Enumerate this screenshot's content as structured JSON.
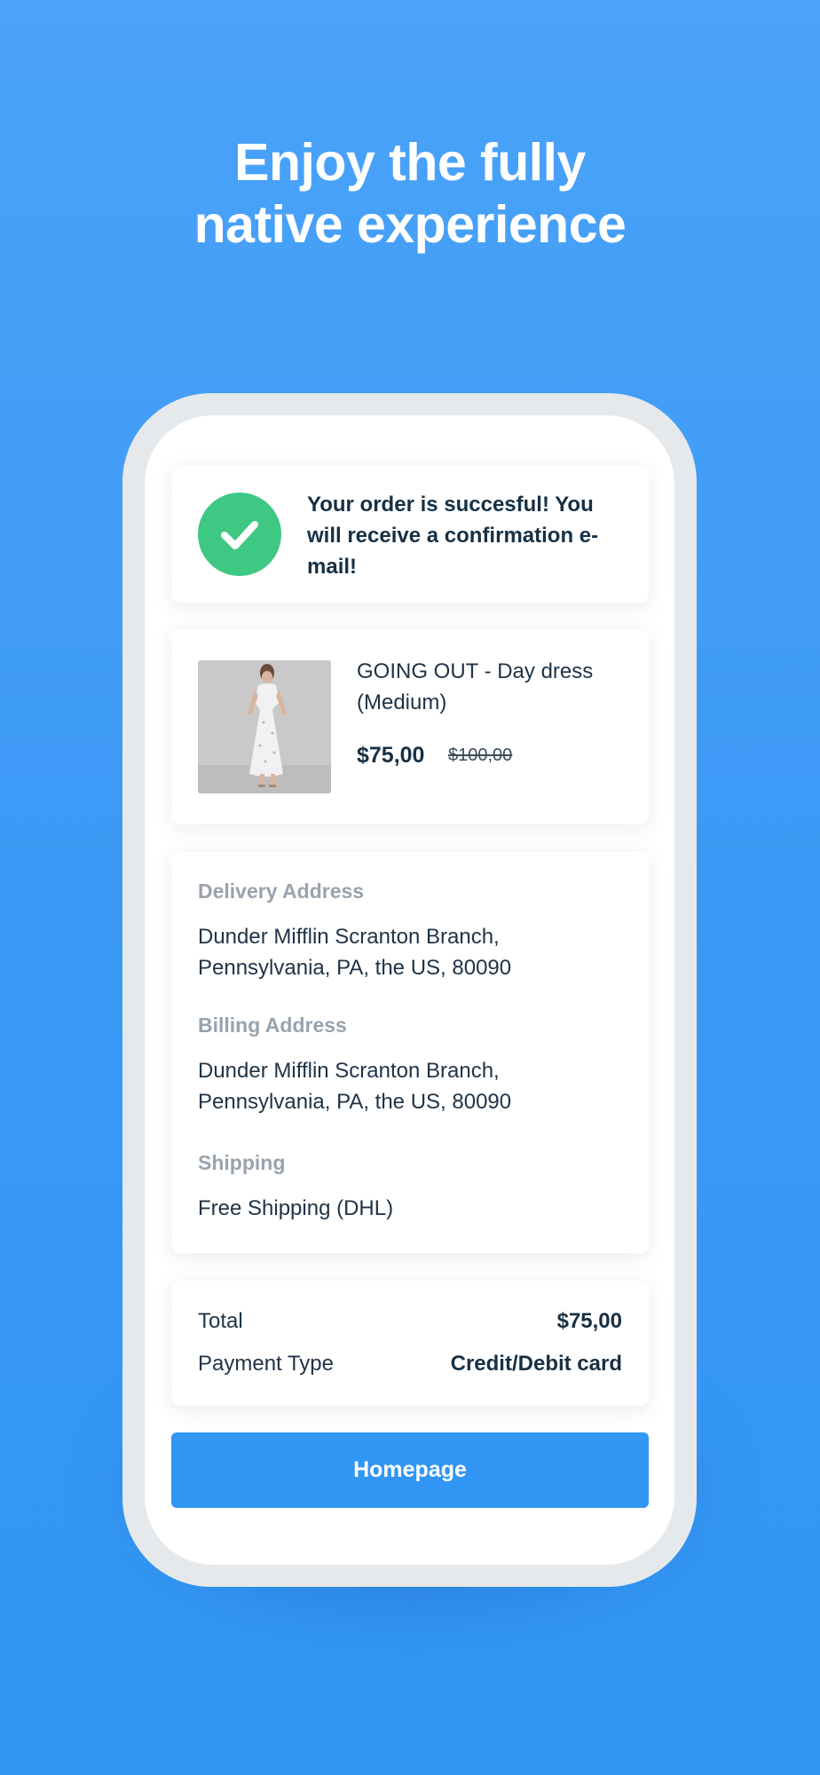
{
  "headline": {
    "line1": "Enjoy the fully",
    "line2": "native experience"
  },
  "success": {
    "icon": "checkmark-icon",
    "message": "Your order is succesful! You will receive a confirmation e-mail!",
    "color": "#3fc784"
  },
  "product": {
    "image": "dress-product-photo",
    "name": "GOING OUT - Day dress (Medium)",
    "price": "$75,00",
    "original_price": "$100,00"
  },
  "address": {
    "delivery_label": "Delivery Address",
    "delivery_value": "Dunder Mifflin Scranton Branch, Pennsylvania, PA, the US, 80090",
    "billing_label": "Billing Address",
    "billing_value": "Dunder Mifflin Scranton Branch, Pennsylvania, PA, the US, 80090",
    "shipping_label": "Shipping",
    "shipping_value": "Free Shipping (DHL)"
  },
  "summary": {
    "total_label": "Total",
    "total_value": "$75,00",
    "payment_label": "Payment Type",
    "payment_value": "Credit/Debit card"
  },
  "actions": {
    "homepage_label": "Homepage",
    "accent_color": "#3196f4"
  }
}
